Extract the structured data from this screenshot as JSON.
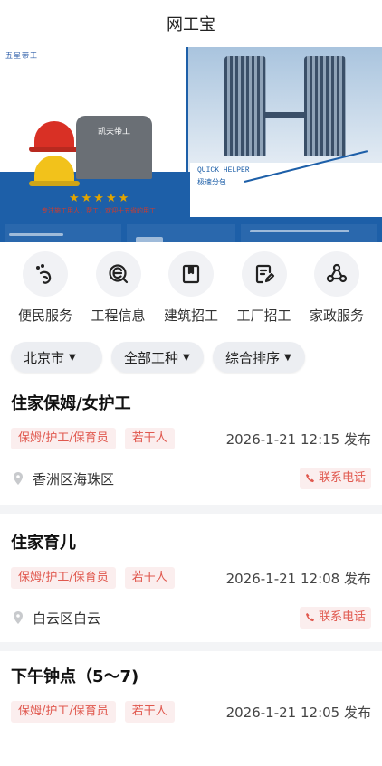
{
  "app": {
    "title": "网工宝"
  },
  "banner": {
    "brand": "五星带工",
    "shirt_text": "凯夫带工",
    "stars": "★★★★★",
    "caption": "专注施工用人，帮工，欢迎十五省的用工",
    "quick_helper": "QUICK HELPER",
    "quick_sub": "极速分包",
    "slides": 5,
    "active_slide": 4
  },
  "categories": [
    {
      "label": "便民服务",
      "icon": "footprint-icon"
    },
    {
      "label": "工程信息",
      "icon": "search-e-icon"
    },
    {
      "label": "建筑招工",
      "icon": "bookmark-icon"
    },
    {
      "label": "工厂招工",
      "icon": "edit-document-icon"
    },
    {
      "label": "家政服务",
      "icon": "share-network-icon"
    }
  ],
  "filters": [
    {
      "label": "北京市",
      "icon": "caret-down-icon"
    },
    {
      "label": "全部工种",
      "icon": "caret-down-icon"
    },
    {
      "label": "综合排序",
      "icon": "caret-down-icon"
    }
  ],
  "jobs": [
    {
      "title": "住家保姆/女护工",
      "tags": [
        "保姆/护工/保育员",
        "若干人"
      ],
      "time": "2026-1-21 12:15 发布",
      "location": "香洲区海珠区",
      "call": "联系电话"
    },
    {
      "title": "住家育儿",
      "tags": [
        "保姆/护工/保育员",
        "若干人"
      ],
      "time": "2026-1-21 12:08 发布",
      "location": "白云区白云",
      "call": "联系电话"
    },
    {
      "title": "下午钟点（5～7)",
      "tags": [
        "保姆/护工/保育员",
        "若干人"
      ],
      "time": "2026-1-21 12:05 发布"
    }
  ],
  "colors": {
    "accent_red": "#e0584e",
    "tag_bg": "#fbeeee",
    "banner_blue": "#1d5fa8"
  }
}
